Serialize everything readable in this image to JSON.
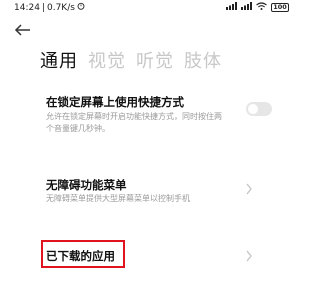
{
  "status": {
    "time": "14:24",
    "speed": "0.7K/s",
    "battery": "100"
  },
  "tabs": [
    {
      "label": "通用"
    },
    {
      "label": "视觉"
    },
    {
      "label": "听觉"
    },
    {
      "label": "肢体"
    }
  ],
  "settings": {
    "shortcut": {
      "title": "在锁定屏幕上使用快捷方式",
      "desc": "允许在锁定屏幕时开启功能快捷方式，同时按住两个音量键几秒钟。",
      "enabled": false
    },
    "accessibility_menu": {
      "title": "无障碍功能菜单",
      "desc": "无障碍菜单提供大型屏幕菜单以控制手机"
    },
    "downloaded_apps": {
      "title": "已下载的应用"
    }
  },
  "colors": {
    "highlight_border": "#e0141e",
    "inactive_tab": "#c8c8c8",
    "toggle_off": "#e6e6e6"
  }
}
